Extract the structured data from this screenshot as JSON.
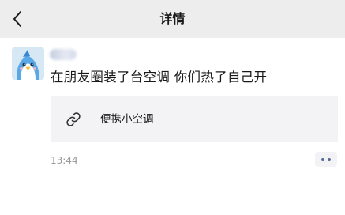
{
  "nav": {
    "title": "详情",
    "back_icon": "chevron-left-icon"
  },
  "post": {
    "author_name": "",
    "text": "在朋友圈装了台空调 你们热了自己开",
    "link": {
      "title": "便携小空调",
      "icon": "link-icon"
    },
    "time": "13:44",
    "more_icon": "more-dots-icon"
  },
  "colors": {
    "nav_bg": "#ededed",
    "link_card_bg": "#f3f3f5",
    "time_text": "#9a9a9a",
    "more_dots": "#576b95"
  }
}
